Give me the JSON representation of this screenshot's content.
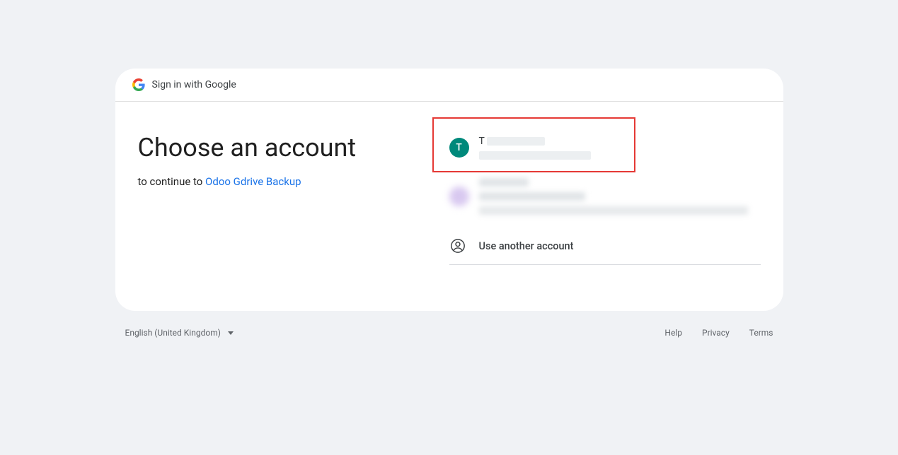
{
  "header": {
    "brand_text": "Sign in with Google"
  },
  "main": {
    "title": "Choose an account",
    "subtitle_prefix": "to continue to ",
    "app_name": "Odoo Gdrive Backup"
  },
  "accounts": [
    {
      "avatar_letter": "T",
      "avatar_color": "teal",
      "name_first": "T"
    }
  ],
  "use_another": "Use another account",
  "footer": {
    "language": "English (United Kingdom)",
    "links": {
      "help": "Help",
      "privacy": "Privacy",
      "terms": "Terms"
    }
  }
}
